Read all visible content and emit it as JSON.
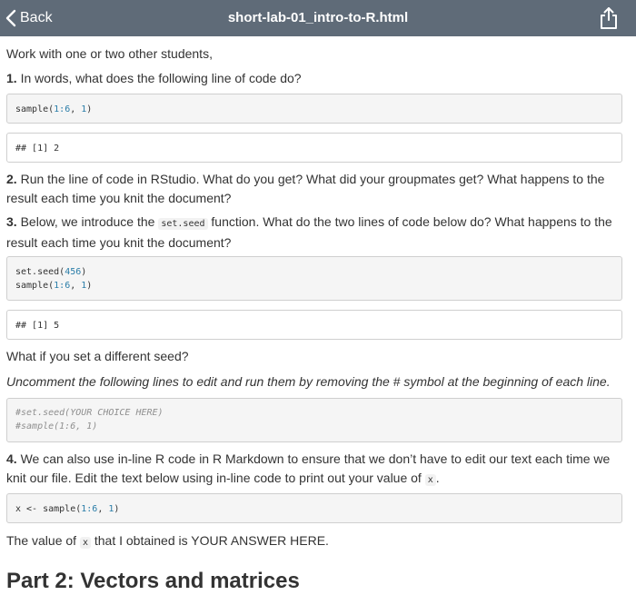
{
  "topbar": {
    "back_label": "Back",
    "title": "short-lab-01_intro-to-R.html"
  },
  "content": {
    "intro": "Work with one or two other students,",
    "q1": {
      "number": "1.",
      "text": "In words, what does the following line of code do?"
    },
    "code1": {
      "fn": "sample(",
      "args": "1:6",
      "sep": ", ",
      "size": "1",
      "close": ")"
    },
    "out1": "## [1] 2",
    "q2": {
      "number": "2.",
      "text": "Run the line of code in RStudio. What do you get? What did your groupmates get? What happens to the result each time you knit the document?"
    },
    "q3": {
      "number": "3.",
      "text_a": "Below, we introduce the",
      "inline_code": "set.seed",
      "text_b": "function. What do the two lines of code below do? What happens to the result each time you knit the document?"
    },
    "code3": {
      "line1_fn": "set.seed(",
      "line1_arg": "456",
      "line1_close": ")",
      "line2_fn": "sample(",
      "line2_args": "1:6",
      "line2_sep": ", ",
      "line2_size": "1",
      "line2_close": ")"
    },
    "out3": "## [1] 5",
    "seed_question": "What if you set a different seed?",
    "uncomment_instruction": "Uncomment the following lines to edit and run them by removing the # symbol at the beginning of each line.",
    "code_commented": {
      "line1": "#set.seed(YOUR CHOICE HERE)",
      "line2": "#sample(1:6, 1)"
    },
    "q4": {
      "number": "4.",
      "text_a": "We can also use in-line R code in R Markdown to ensure that we don’t have to edit our text each time we knit our file. Edit the text below using in-line code to print out your value of",
      "inline_code": "x",
      "text_b": "."
    },
    "code4": {
      "lhs": "x <- sample(",
      "args": "1:6",
      "sep": ", ",
      "size": "1",
      "close": ")"
    },
    "answer": {
      "text_a": "The value of",
      "inline_code": "x",
      "text_b": "that I obtained is YOUR ANSWER HERE."
    },
    "next_heading": "Part 2: Vectors and matrices"
  },
  "colors": {
    "topbar": "#5f6b78",
    "number": "#2a7da8",
    "comment": "#8f8f8f"
  }
}
